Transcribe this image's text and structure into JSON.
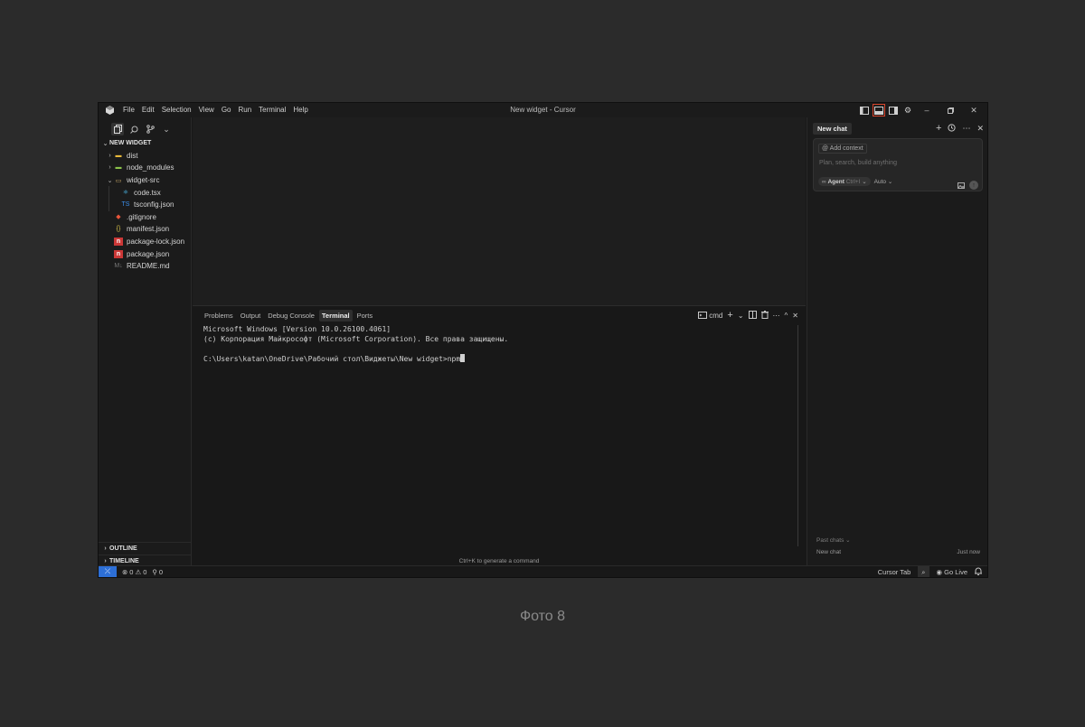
{
  "window": {
    "title": "New widget - Cursor",
    "menu": [
      "File",
      "Edit",
      "Selection",
      "View",
      "Go",
      "Run",
      "Terminal",
      "Help"
    ]
  },
  "explorer": {
    "root": "NEW WIDGET",
    "items": [
      {
        "label": "dist",
        "icon": "folder-dist-icon",
        "chev": "›",
        "indent": 0
      },
      {
        "label": "node_modules",
        "icon": "folder-node-icon",
        "chev": "›",
        "indent": 0
      },
      {
        "label": "widget-src",
        "icon": "folder-open-icon",
        "chev": "⌄",
        "indent": 0
      },
      {
        "label": "code.tsx",
        "icon": "react-file-icon",
        "chev": "",
        "indent": 1
      },
      {
        "label": "tsconfig.json",
        "icon": "ts-config-icon",
        "chev": "",
        "indent": 1
      },
      {
        "label": ".gitignore",
        "icon": "git-icon",
        "chev": "",
        "indent": 0
      },
      {
        "label": "manifest.json",
        "icon": "json-braces-icon",
        "chev": "",
        "indent": 0
      },
      {
        "label": "package-lock.json",
        "icon": "npm-icon",
        "chev": "",
        "indent": 0
      },
      {
        "label": "package.json",
        "icon": "npm-icon",
        "chev": "",
        "indent": 0
      },
      {
        "label": "README.md",
        "icon": "markdown-icon",
        "chev": "",
        "indent": 0
      }
    ],
    "outline": "OUTLINE",
    "timeline": "TIMELINE"
  },
  "panel": {
    "tabs": [
      "Problems",
      "Output",
      "Debug Console",
      "Terminal",
      "Ports"
    ],
    "active_tab": "Terminal",
    "shell": "cmd",
    "terminal_lines": [
      "Microsoft Windows [Version 10.0.26100.4061]",
      "(c) Корпорация Майкрософт (Microsoft Corporation). Все права защищены.",
      "",
      "C:\\Users\\katan\\OneDrive\\Рабочий стол\\Виджеты\\New widget>npm"
    ],
    "hint": "Ctrl+K to generate a command"
  },
  "chat": {
    "tab": "New chat",
    "add_context": "Add context",
    "placeholder": "Plan, search, build anything",
    "agent": "Agent",
    "agent_shortcut": "Ctrl+I",
    "model": "Auto",
    "past_chats": "Past chats",
    "past_item": "New chat",
    "past_time": "Just now"
  },
  "status": {
    "errors": "0",
    "warnings": "0",
    "ports": "0",
    "cursor_tab": "Cursor Tab",
    "go_live": "Go Live"
  },
  "caption": "Фото 8",
  "colors": {
    "accent_remote": "#2d6fd6",
    "highlight": "#d9442b"
  }
}
